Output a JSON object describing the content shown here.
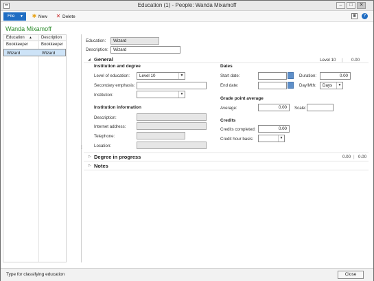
{
  "window": {
    "title": "Education (1) - People: Wanda Mixamoff"
  },
  "toolbar": {
    "file": "File",
    "new": "New",
    "delete": "Delete"
  },
  "page_heading": "Wanda Mixamoff",
  "list": {
    "headers": [
      "Education",
      "Description"
    ],
    "rows": [
      {
        "education": "Bookkeeper",
        "description": "Bookkeeper",
        "selected": false
      },
      {
        "education": "Wizard",
        "description": "Wizard",
        "selected": true
      }
    ]
  },
  "header_fields": {
    "education_label": "Education:",
    "education_value": "Wizard",
    "description_label": "Description:",
    "description_value": "Wizard"
  },
  "general": {
    "title": "General",
    "summary_level": "Level 10",
    "summary_value": "0.00",
    "institution_and_degree": {
      "title": "Institution and degree",
      "level_label": "Level of education:",
      "level_value": "Level 10",
      "secondary_label": "Secondary emphasis:",
      "secondary_value": "",
      "institution_label": "Institution:",
      "institution_value": ""
    },
    "institution_information": {
      "title": "Institution information",
      "description_label": "Description:",
      "internet_label": "Internet address:",
      "telephone_label": "Telephone:",
      "location_label": "Location:"
    },
    "dates": {
      "title": "Dates",
      "start_label": "Start date:",
      "end_label": "End date:",
      "duration_label": "Duration:",
      "duration_value": "0.00",
      "daymth_label": "Day/Mth:",
      "daymth_value": "Days"
    },
    "gpa": {
      "title": "Grade point average",
      "average_label": "Average:",
      "average_value": "0.00",
      "scale_label": "Scale:",
      "scale_value": ""
    },
    "credits": {
      "title": "Credits",
      "completed_label": "Credits completed:",
      "completed_value": "0.00",
      "hour_basis_label": "Credit hour basis:",
      "hour_basis_value": ""
    }
  },
  "degree_in_progress": {
    "title": "Degree in progress",
    "value1": "0.00",
    "value2": "0.00"
  },
  "notes": {
    "title": "Notes"
  },
  "statusbar": {
    "text": "Type for classifying education",
    "close": "Close"
  },
  "colors": {
    "accent": "#1f6dc3",
    "heading": "#2a8a2a",
    "selection": "#cde3f7"
  }
}
